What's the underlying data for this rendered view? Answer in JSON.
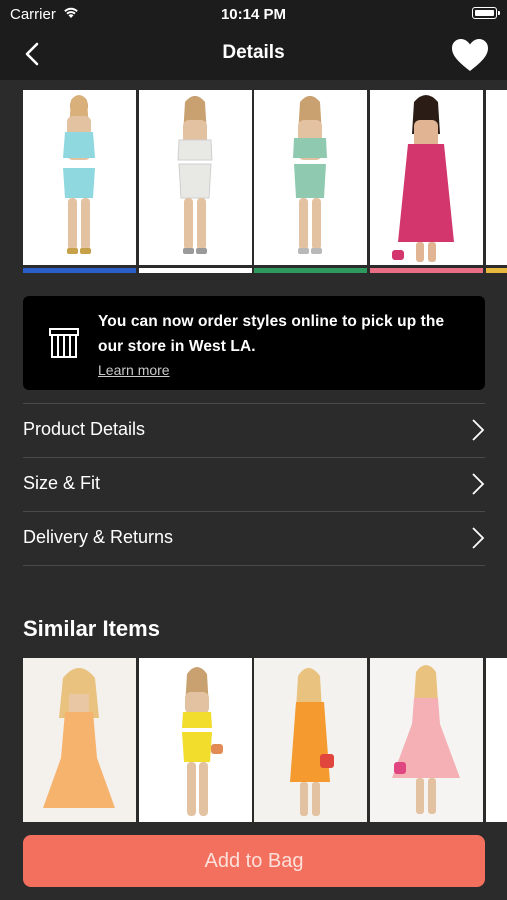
{
  "status_bar": {
    "carrier": "Carrier",
    "time": "10:14 PM"
  },
  "header": {
    "title": "Details",
    "back_icon": "chevron-left-icon",
    "favorite_icon": "heart-icon"
  },
  "gallery": {
    "items": [
      {
        "dress_color": "#8fd8e0",
        "swatch": "#2a5fc9"
      },
      {
        "dress_color": "#e8e8e4",
        "swatch": "#ffffff"
      },
      {
        "dress_color": "#8fcab0",
        "swatch": "#2e9a5e"
      },
      {
        "dress_color": "#d2366d",
        "swatch": "#e86f85"
      },
      {
        "dress_color": "#f1c85c",
        "swatch": "#e8b93f"
      }
    ]
  },
  "banner": {
    "icon": "store-icon",
    "message": "You can now order styles online to pick up the our store in West LA.",
    "link": "Learn more"
  },
  "rows": [
    {
      "label": "Product Details"
    },
    {
      "label": "Size & Fit"
    },
    {
      "label": "Delivery & Returns"
    }
  ],
  "similar": {
    "title": "Similar Items",
    "items": [
      {
        "dress_color": "#f6b36e"
      },
      {
        "dress_color": "#f2dc2c"
      },
      {
        "dress_color": "#f49a2e"
      },
      {
        "dress_color": "#f4b0b4"
      },
      {
        "dress_color": "#f3c9a7"
      }
    ]
  },
  "actions": {
    "add_to_bag": "Add to Bag"
  }
}
